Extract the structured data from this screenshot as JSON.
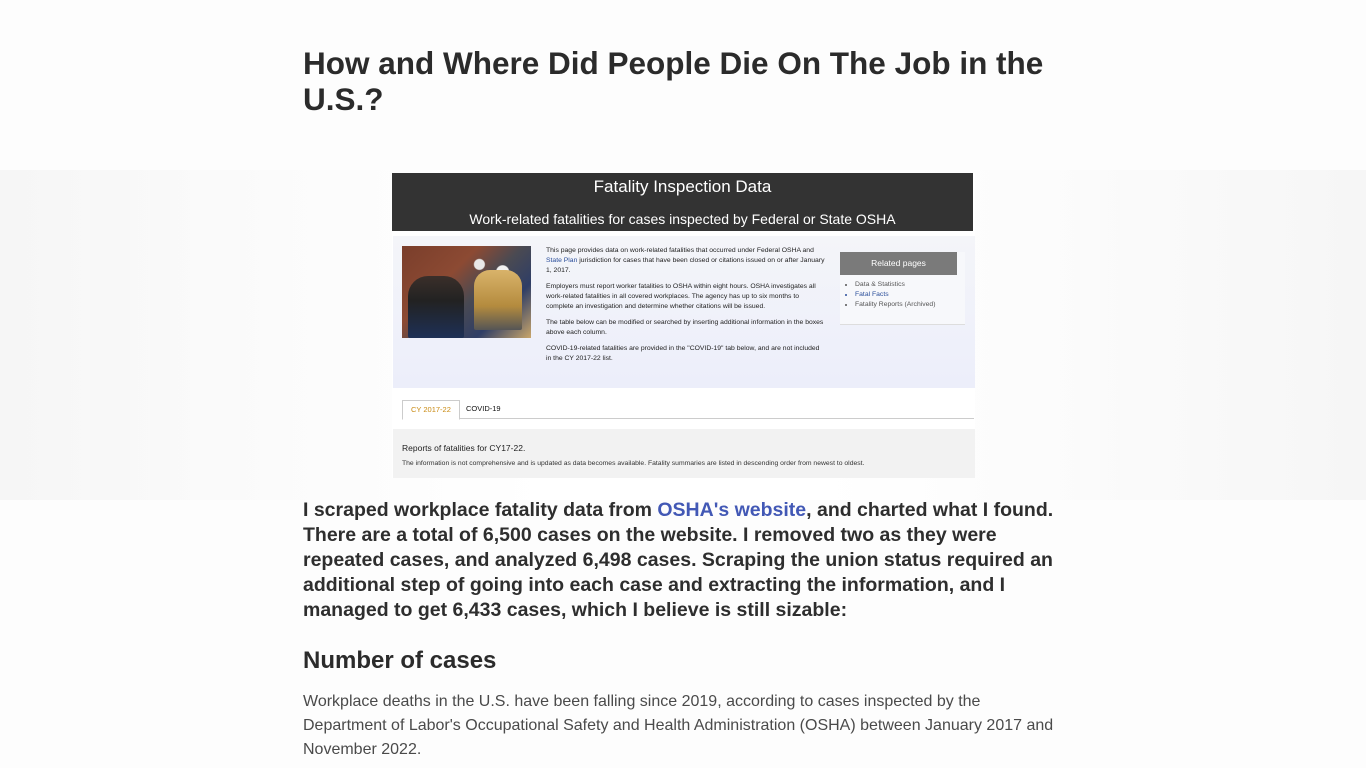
{
  "article": {
    "title": "How and Where Did People Die On The Job in the U.S.?",
    "hero": {
      "header_title": "Fatality Inspection Data",
      "header_subtitle": "Work-related fatalities for cases inspected by Federal or State OSHA",
      "paragraphs": {
        "p1_before": "This page provides data on work-related fatalities that occurred under Federal OSHA and ",
        "p1_link": "State Plan",
        "p1_after": " jurisdiction for cases that have been closed or citations issued on or after January 1, 2017.",
        "p2": "Employers must report worker fatalities to OSHA within eight hours. OSHA investigates all work-related fatalities in all covered workplaces. The agency has up to six months to complete an investigation and determine whether citations will be issued.",
        "p3": "The table below can be modified or searched by inserting additional information in the boxes above each column.",
        "p4": "COVID-19-related fatalities are provided in the \"COVID-19\" tab below, and are not included in the CY 2017-22 list."
      },
      "related_pages": {
        "heading": "Related pages",
        "items": [
          "Data & Statistics",
          "Fatal Facts",
          "Fatality Reports (Archived)"
        ]
      },
      "tabs": [
        "CY 2017-22",
        "COVID-19"
      ],
      "footer_title": "Reports of fatalities for CY17-22.",
      "footer_note": "The information is not comprehensive and is updated as data becomes available. Fatality summaries are listed in descending order from newest to oldest."
    },
    "intro": {
      "before_link": "I scraped workplace fatality data from ",
      "link_text": "OSHA's website",
      "after_link": ", and charted what I found. There are a total of 6,500 cases on the website. I removed two as they were repeated cases, and analyzed 6,498 cases. Scraping the union status required an additional step of going into each case and extracting the information, and I managed to get 6,433 cases, which I believe is still sizable:"
    },
    "section": {
      "title": "Number of cases",
      "text": "Workplace deaths in the U.S. have been falling since 2019, according to cases inspected by the Department of Labor's Occupational Safety and Health Administration (OSHA) between January 2017 and November 2022."
    }
  },
  "colors": {
    "link": "#4258b5",
    "hero_header_bg": "#333333",
    "active_tab": "#c98a12"
  }
}
